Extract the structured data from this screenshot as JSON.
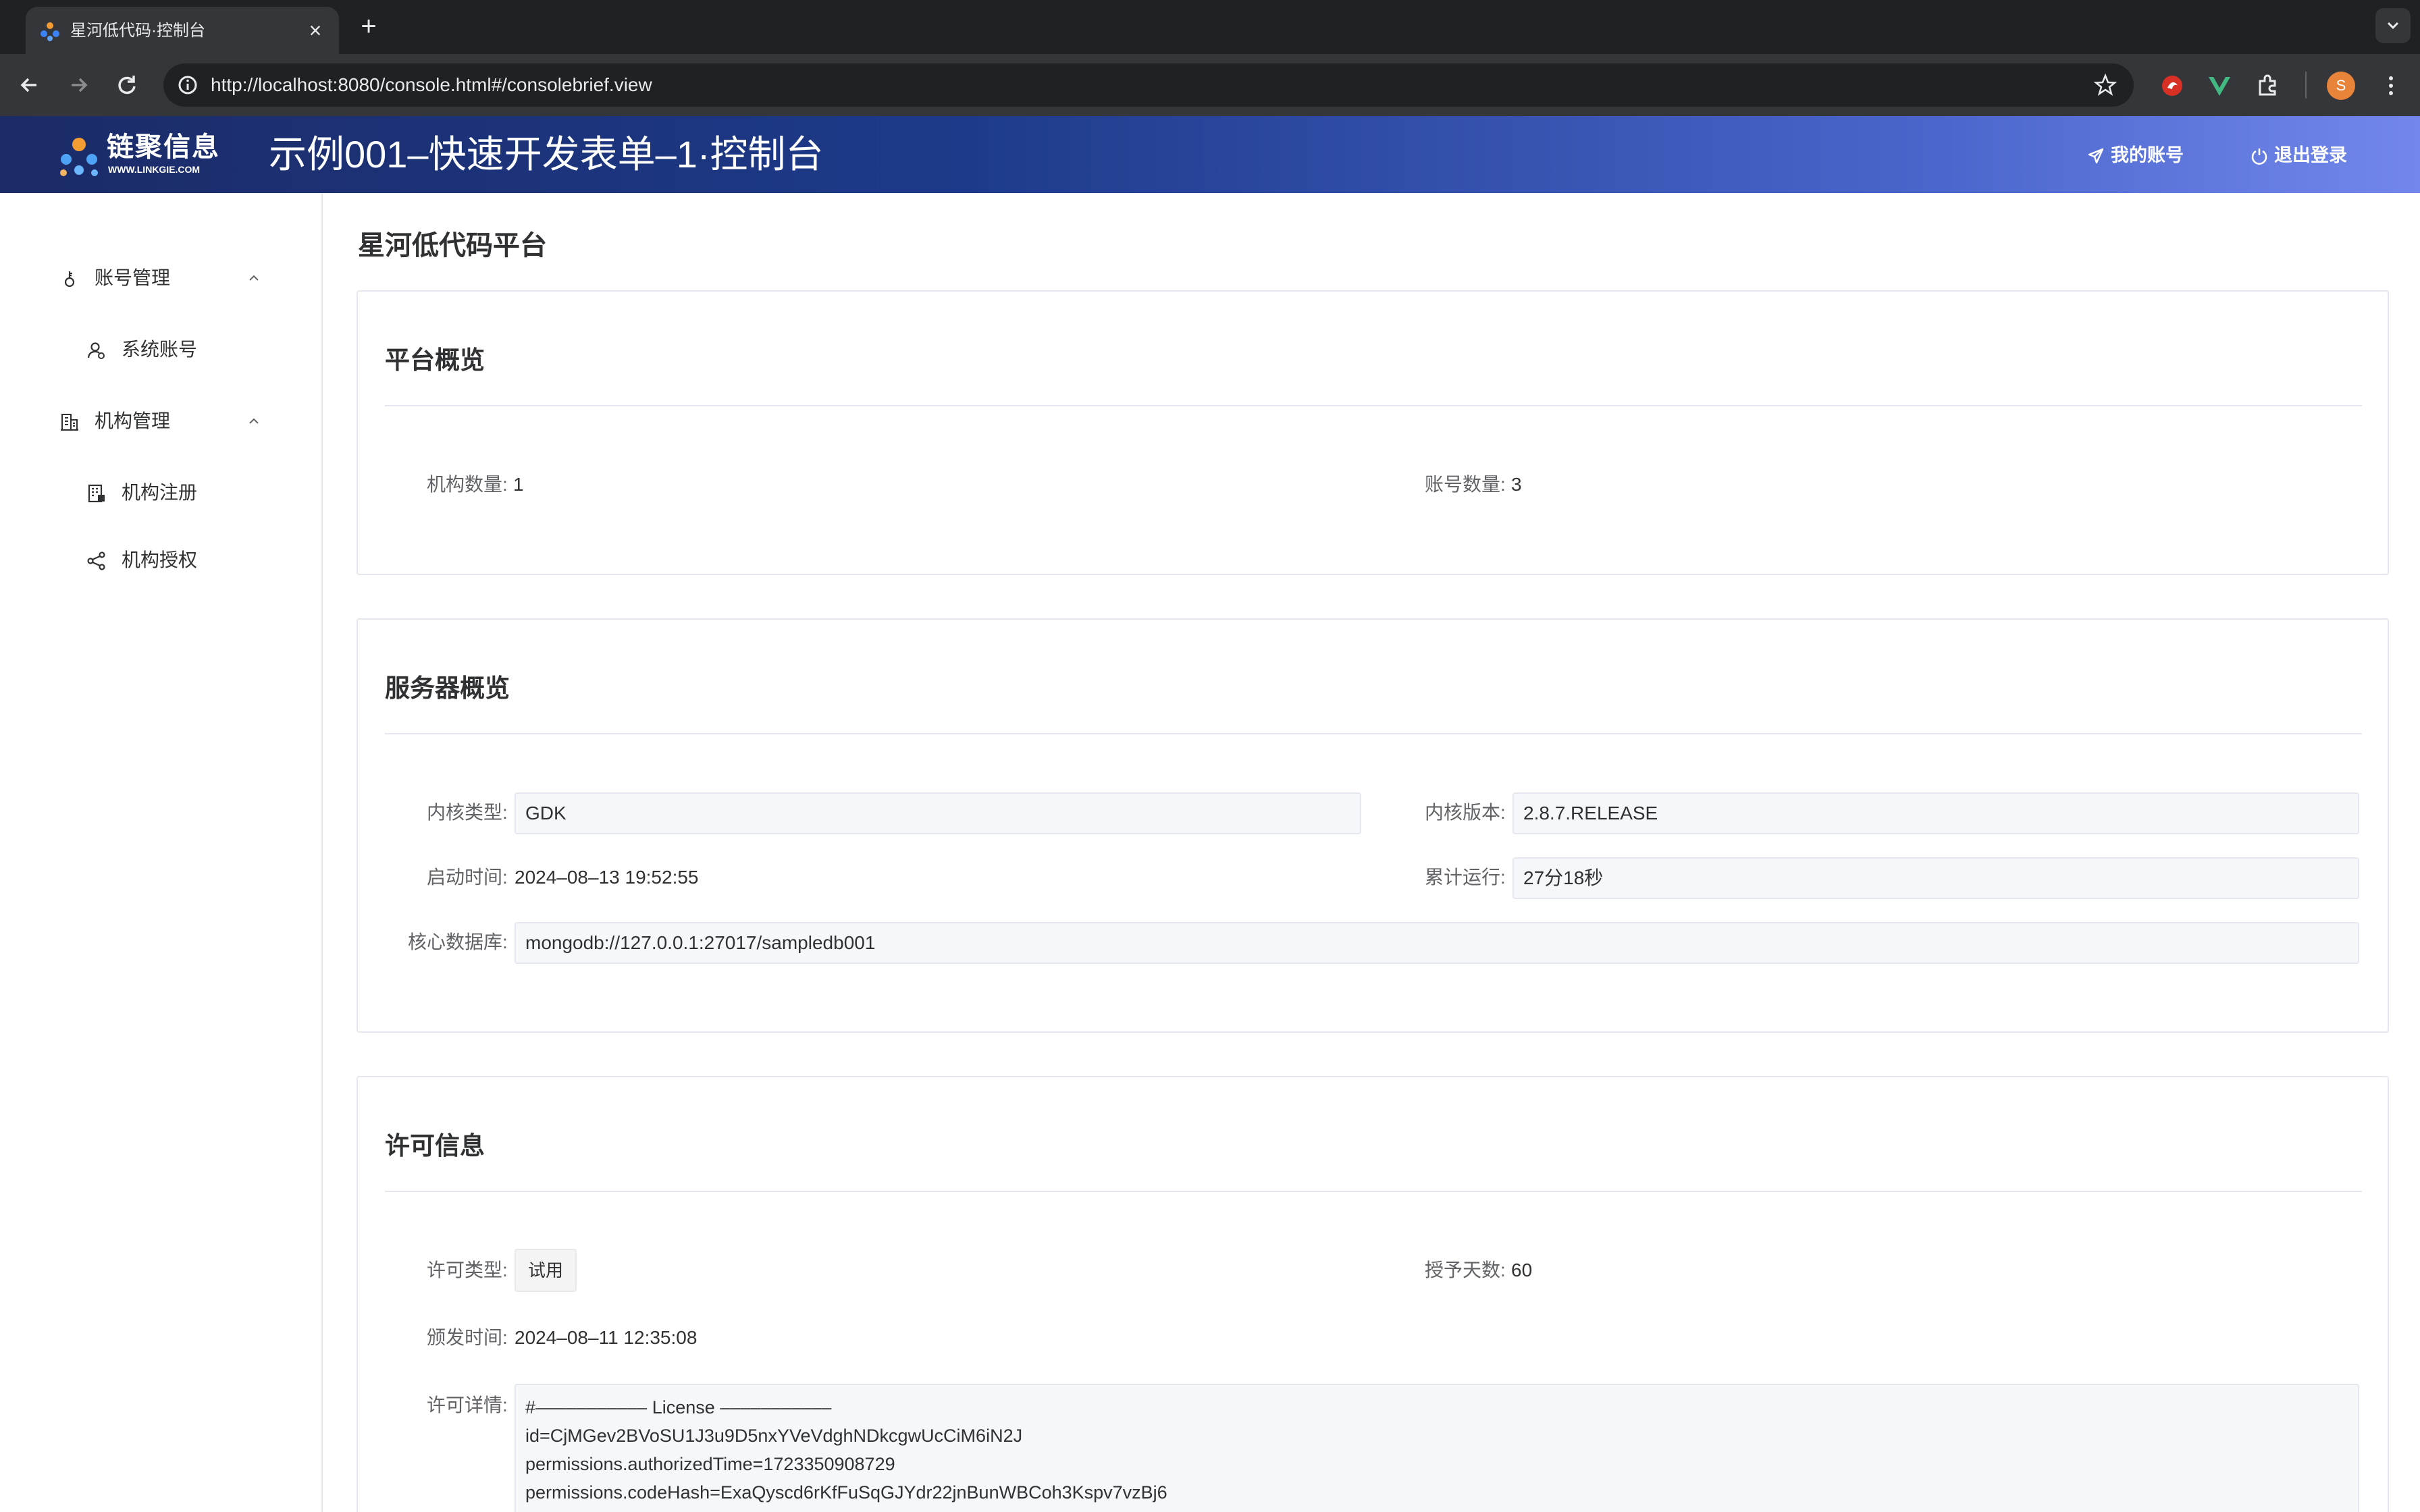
{
  "browser": {
    "tab_title": "星河低代码·控制台",
    "close_glyph": "×",
    "new_tab_glyph": "+",
    "url": "http://localhost:8080/console.html#/consolebrief.view",
    "profile_initial": "S"
  },
  "header": {
    "logo_text": "链聚信息",
    "logo_sub": "WWW.LINKGIE.COM",
    "title": "示例001–快速开发表单–1·控制台",
    "my_account": "我的账号",
    "logout": "退出登录"
  },
  "sidebar": {
    "groups": [
      {
        "label": "账号管理",
        "icon": "key-icon",
        "expanded": true,
        "items": [
          {
            "label": "系统账号",
            "icon": "user-icon"
          }
        ]
      },
      {
        "label": "机构管理",
        "icon": "building-icon",
        "expanded": true,
        "items": [
          {
            "label": "机构注册",
            "icon": "registry-icon"
          },
          {
            "label": "机构授权",
            "icon": "share-icon"
          }
        ]
      }
    ]
  },
  "main": {
    "page_title": "星河低代码平台",
    "overview": {
      "title": "平台概览",
      "org_count_label": "机构数量:",
      "org_count": "1",
      "account_count_label": "账号数量:",
      "account_count": "3"
    },
    "server": {
      "title": "服务器概览",
      "kernel_type_label": "内核类型:",
      "kernel_type": "GDK",
      "kernel_version_label": "内核版本:",
      "kernel_version": "2.8.7.RELEASE",
      "start_time_label": "启动时间:",
      "start_time": "2024–08–13 19:52:55",
      "uptime_label": "累计运行:",
      "uptime": "27分18秒",
      "core_db_label": "核心数据库:",
      "core_db": "mongodb://127.0.0.1:27017/sampledb001"
    },
    "license": {
      "title": "许可信息",
      "type_label": "许可类型:",
      "type": "试用",
      "days_label": "授予天数:",
      "days": "60",
      "issued_label": "颁发时间:",
      "issued": "2024–08–11 12:35:08",
      "detail_label": "许可详情:",
      "detail_lines": [
        "#––––––––––– License –––––––––––",
        "id=CjMGev2BVoSU1J3u9D5nxYVeVdghNDkcgwUcCiM6iN2J",
        "permissions.authorizedTime=1723350908729",
        "permissions.codeHash=ExaQyscd6rKfFuSqGJYdr22jnBunWBCoh3Kspv7vzBj6"
      ]
    }
  },
  "colors": {
    "header_start": "#1b2b67",
    "header_end": "#7387ea",
    "chrome_dark": "#202124",
    "chrome_bar": "#35363a"
  }
}
